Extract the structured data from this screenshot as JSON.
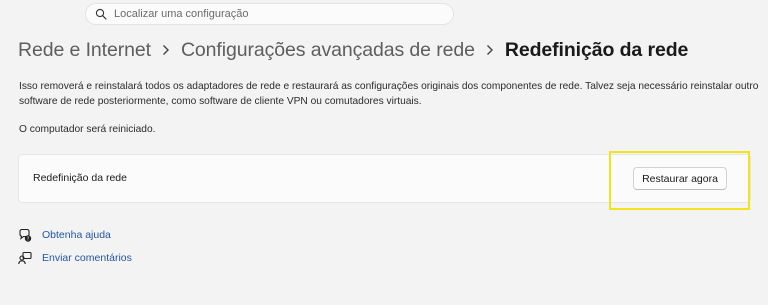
{
  "search": {
    "placeholder": "Localizar uma configuração"
  },
  "breadcrumb": {
    "items": [
      "Rede e Internet",
      "Configurações avançadas de rede"
    ],
    "current": "Redefinição da rede"
  },
  "description": "Isso removerá e reinstalará todos os adaptadores de rede e restaurará as configurações originais dos componentes de rede. Talvez seja necessário reinstalar outro software de rede posteriormente, como software de cliente VPN ou comutadores virtuais.",
  "restart_note": "O computador será reiniciado.",
  "reset_card": {
    "label": "Redefinição da rede",
    "button_label": "Restaurar agora"
  },
  "links": {
    "help": "Obtenha ajuda",
    "feedback": "Enviar comentários"
  },
  "colors": {
    "background": "#f3f3f3",
    "link": "#2456a4",
    "highlight": "#f2e31c"
  }
}
